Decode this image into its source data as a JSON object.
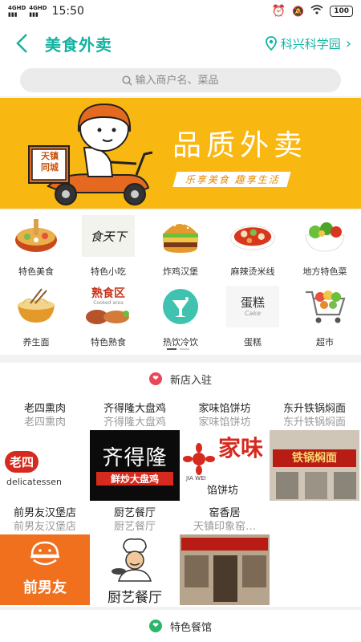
{
  "status_bar": {
    "network1": "4GHD",
    "network2": "4GHD",
    "time": "15:50",
    "battery": "100"
  },
  "header": {
    "title": "美食外卖",
    "location": "科兴科学园"
  },
  "search": {
    "placeholder": "输入商户名、菜品"
  },
  "banner": {
    "logo_line1": "天镇",
    "logo_line2": "同城",
    "headline": "品质外卖",
    "tagline": "乐享美食 趣享生活"
  },
  "categories": [
    {
      "label": "特色美食",
      "icon": "hotpot-icon"
    },
    {
      "label": "特色小吃",
      "icon": "snack-icon"
    },
    {
      "label": "炸鸡汉堡",
      "icon": "burger-icon"
    },
    {
      "label": "麻辣烫米线",
      "icon": "noodle-bowl-icon"
    },
    {
      "label": "地方特色菜",
      "icon": "salad-icon"
    },
    {
      "label": "养生面",
      "icon": "noodle-icon"
    },
    {
      "label": "特色熟食",
      "icon": "deli-icon"
    },
    {
      "label": "热饮冷饮",
      "icon": "drink-icon"
    },
    {
      "label": "蛋糕",
      "icon": "cake-icon"
    },
    {
      "label": "超市",
      "icon": "cart-icon"
    }
  ],
  "category_images": {
    "snack_logo": "食天下",
    "deli_sign": "熟食区",
    "deli_sign_en": "Cooked area",
    "cake_cn": "蛋糕",
    "cake_en": "Cake"
  },
  "sections": {
    "new_stores": "新店入驻",
    "featured": "特色餐馆"
  },
  "stores": [
    {
      "name": "老四熏肉",
      "sub": "老四熏肉",
      "sign": "老四",
      "sign_sub": "delicatessen"
    },
    {
      "name": "齐得隆大盘鸡",
      "sub": "齐得隆大盘鸡",
      "sign": "齐得隆",
      "sign_sub": "鲜炒大盘鸡"
    },
    {
      "name": "家味馅饼坊",
      "sub": "家味馅饼坊",
      "sign": "家味",
      "sign_sub": "馅饼坊",
      "sign_en": "JIA WEI"
    },
    {
      "name": "东升铁锅焖面",
      "sub": "东升铁锅焖面",
      "sign": "铁锅焖面"
    },
    {
      "name": "前男友汉堡店",
      "sub": "前男友汉堡店",
      "sign": "前男友"
    },
    {
      "name": "厨艺餐厅",
      "sub": "厨艺餐厅",
      "sign": "厨艺餐厅"
    },
    {
      "name": "窑香居",
      "sub": "天镇印象窑…",
      "sign": ""
    }
  ],
  "colors": {
    "accent": "#13b3a0",
    "banner": "#f9b712",
    "heart_red": "#e8475a",
    "heart_green": "#2db56c"
  }
}
